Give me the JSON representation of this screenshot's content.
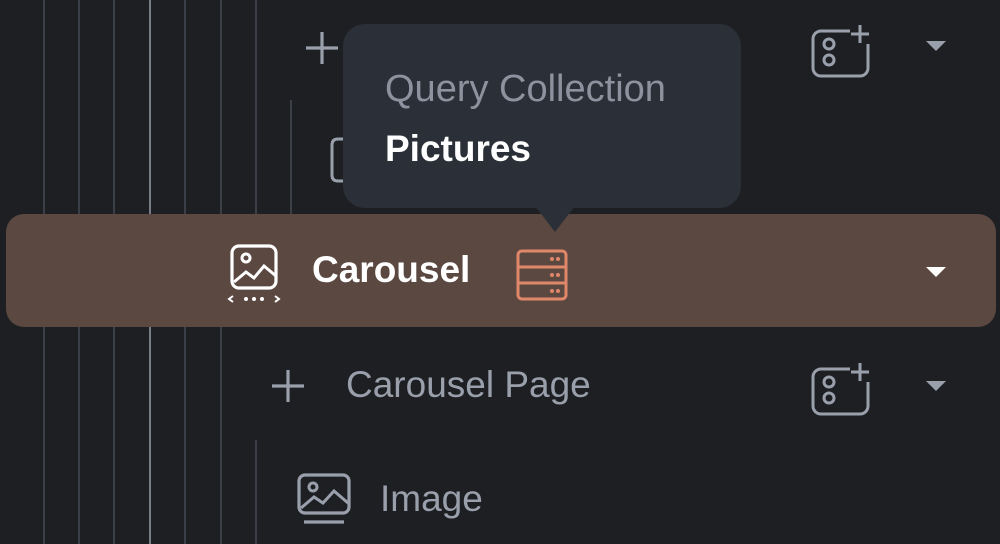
{
  "tooltip": {
    "title": "Query Collection",
    "value": "Pictures"
  },
  "tree": {
    "selected": {
      "label": "Carousel",
      "icon": "carousel-icon",
      "badge_icon": "query-collection-icon",
      "accent": "#e0876a"
    },
    "child": {
      "label": "Carousel Page",
      "icon": "add-icon",
      "action_icon": "add-component-icon"
    },
    "grandchild": {
      "label": "Image",
      "icon": "image-icon"
    }
  },
  "colors": {
    "background": "#1d1f23",
    "selected_row": "#5b4841",
    "tooltip": "#2b3038",
    "text_muted": "#9aa0ab"
  }
}
